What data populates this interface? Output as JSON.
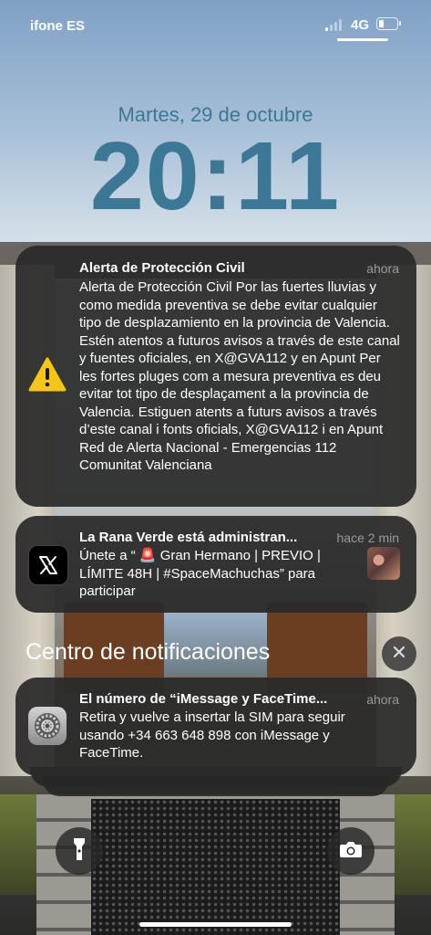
{
  "status_bar": {
    "carrier": "ifone ES",
    "network": "4G",
    "battery_level": 0.25
  },
  "lock": {
    "date": "Martes, 29 de octubre",
    "time": "20:11"
  },
  "notifications": [
    {
      "app": "alert",
      "icon": "warning-icon",
      "title": "Alerta de Protección Civil",
      "time": "ahora",
      "body": "Alerta de Protección Civil Por las fuertes lluvias y como medida preventiva se debe evitar cualquier tipo de desplazamiento en la provincia de Valencia. Estén atentos a futuros avisos a través de este canal y fuentes oficiales, en X@GVA112 y en Apunt Per les fortes pluges com a mesura preventiva es deu evitar tot tipo de desplaçament a la provincia de Valencia. Estiguen atents a futurs avisos a través d’este canal i fonts oficials, X@GVA112 i en Apunt Red de Alerta Nacional - Emergencias 112 Comunitat Valenciana"
    },
    {
      "app": "x",
      "icon": "x-logo-icon",
      "title": "La Rana Verde está administran...",
      "time": "hace 2 min",
      "body": "Únete a “ 🚨 Gran Hermano | PREVIO | LÍMITE 48H | #SpaceMachuchas” para participar"
    }
  ],
  "notification_center": {
    "label": "Centro de notificaciones",
    "clear_icon": "close-icon"
  },
  "center_notifications": [
    {
      "app": "settings",
      "icon": "settings-gear-icon",
      "title": "El número de “iMessage y FaceTime...",
      "time": "ahora",
      "body": "Retira y vuelve a insertar la SIM para seguir usando +34 663 648 898 con iMessage y FaceTime."
    }
  ],
  "quick_actions": {
    "left": "flashlight-icon",
    "right": "camera-icon"
  },
  "colors": {
    "clock": "#3c7896",
    "card_bg": "#2a2a2a",
    "warning_yellow": "#f5c518"
  }
}
